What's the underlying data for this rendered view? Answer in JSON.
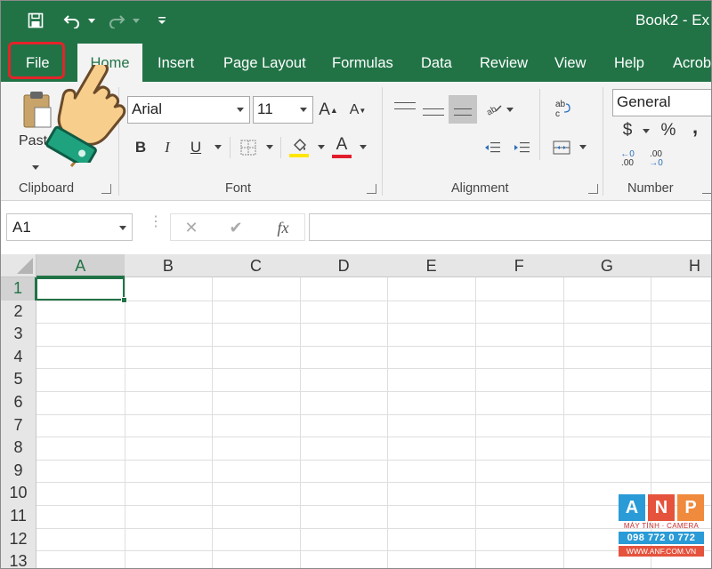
{
  "window": {
    "title": "Book2 - Ex"
  },
  "qat": {
    "save": "save-icon",
    "undo": "undo-icon",
    "redo": "redo-icon",
    "customize": "customize-qat-icon"
  },
  "tabs": [
    {
      "label": "File"
    },
    {
      "label": "Home"
    },
    {
      "label": "Insert"
    },
    {
      "label": "Page Layout"
    },
    {
      "label": "Formulas"
    },
    {
      "label": "Data"
    },
    {
      "label": "Review"
    },
    {
      "label": "View"
    },
    {
      "label": "Help"
    },
    {
      "label": "Acrob"
    }
  ],
  "active_tab": "Home",
  "highlighted_tab": "File",
  "ribbon": {
    "clipboard": {
      "paste_label": "Paste",
      "group_label": "Clipboard"
    },
    "font": {
      "font_name": "Arial",
      "font_size": "11",
      "bold": "B",
      "italic": "I",
      "underline": "U",
      "font_color_letter": "A",
      "grow": "A",
      "shrink": "A",
      "group_label": "Font"
    },
    "alignment": {
      "wrap_label": "ab\nc",
      "group_label": "Alignment"
    },
    "number": {
      "format": "General",
      "currency": "$",
      "percent": "%",
      "comma": ",",
      "inc_decimal": ".00",
      "dec_decimal": ".00",
      "group_label": "Number"
    }
  },
  "formula_bar": {
    "name_box": "A1",
    "cancel": "✕",
    "enter": "✔",
    "fx": "fx",
    "value": ""
  },
  "grid": {
    "columns": [
      "A",
      "B",
      "C",
      "D",
      "E",
      "F",
      "G",
      "H"
    ],
    "rows": [
      "1",
      "2",
      "3",
      "4",
      "5",
      "6",
      "7",
      "8",
      "9",
      "10",
      "11",
      "12",
      "13"
    ],
    "selected_cell": "A1"
  },
  "colors": {
    "brand": "#217346",
    "highlight": "#e4232a",
    "fill_yellow": "#ffe600",
    "font_red": "#e11d2c"
  },
  "watermark": {
    "letters": [
      "A",
      "N",
      "P"
    ],
    "tagline": "MÁY TÍNH · CAMERA",
    "phone": "098 772 0 772",
    "website": "WWW.ANF.COM.VN"
  }
}
